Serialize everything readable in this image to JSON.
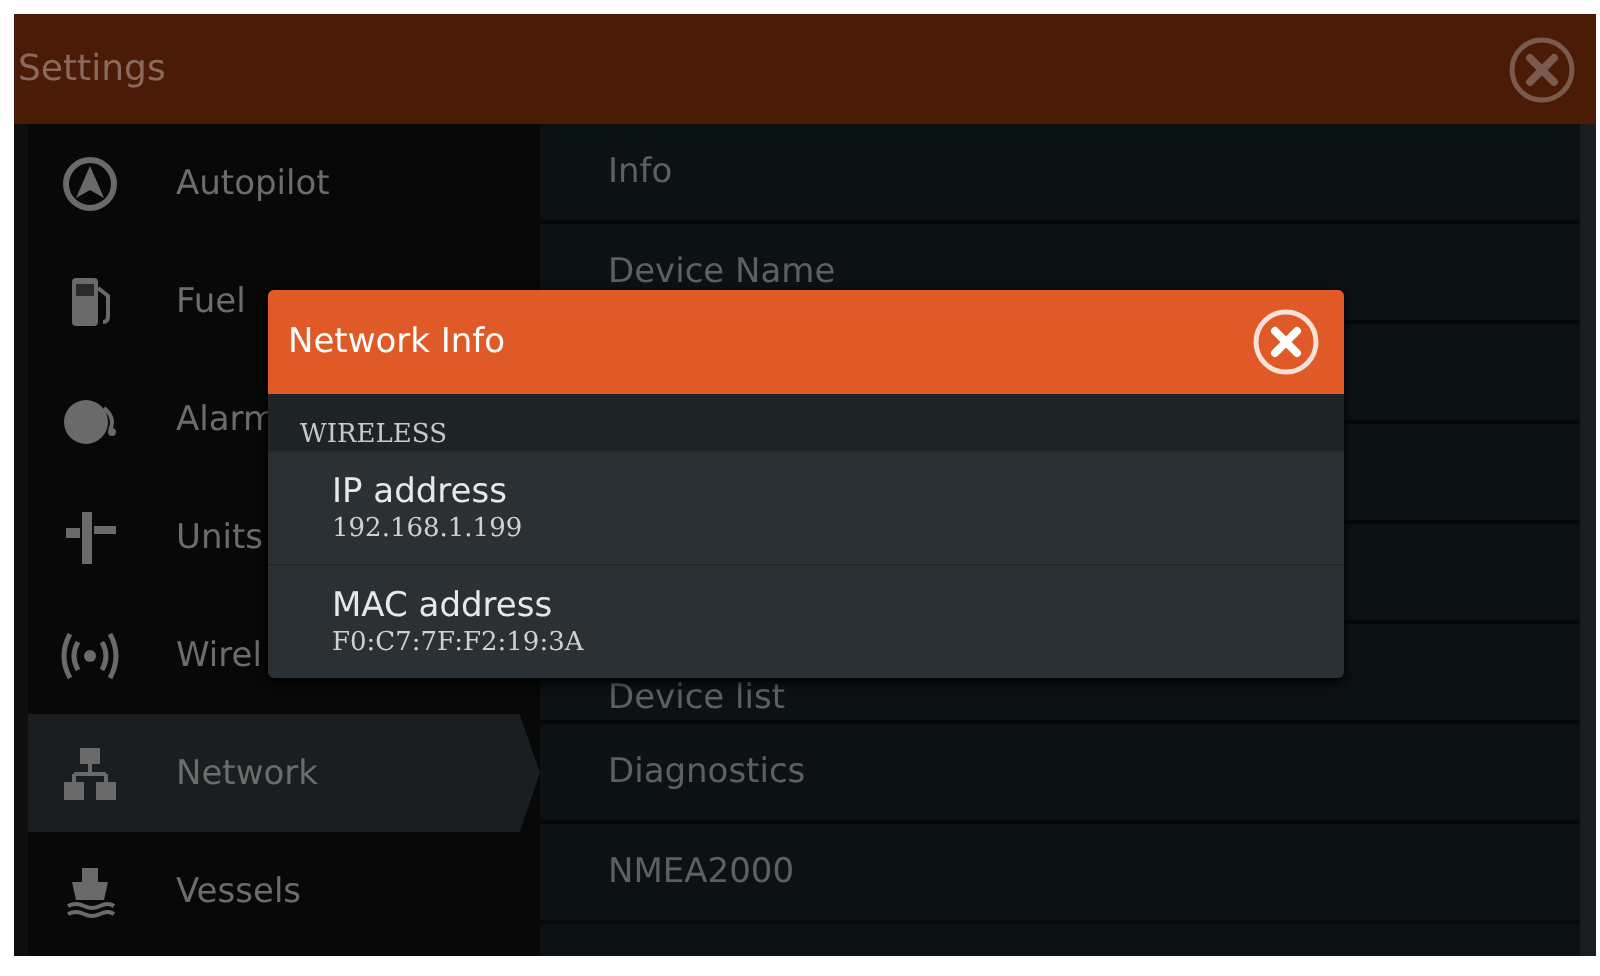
{
  "window": {
    "title": "Settings"
  },
  "sidebar": {
    "items": [
      {
        "label": "Autopilot",
        "kind": "autopilot",
        "selected": false
      },
      {
        "label": "Fuel",
        "kind": "fuel",
        "selected": false
      },
      {
        "label": "Alarm",
        "kind": "alarm",
        "selected": false
      },
      {
        "label": "Units",
        "kind": "units",
        "selected": false
      },
      {
        "label": "Wirel",
        "kind": "wireless",
        "selected": false
      },
      {
        "label": "Network",
        "kind": "network",
        "selected": true
      },
      {
        "label": "Vessels",
        "kind": "vessels",
        "selected": false
      }
    ]
  },
  "panel": {
    "rows_top": [
      {
        "label": "Info"
      },
      {
        "label": "Device Name"
      }
    ],
    "rows_bottom": [
      {
        "label": "Device list"
      },
      {
        "label": "Diagnostics"
      },
      {
        "label": "NMEA2000"
      }
    ]
  },
  "dialog": {
    "title": "Network Info",
    "section": "WIRELESS",
    "rows": [
      {
        "label": "IP address",
        "value": "192.168.1.199"
      },
      {
        "label": "MAC address",
        "value": "F0:C7:7F:F2:19:3A"
      }
    ]
  }
}
